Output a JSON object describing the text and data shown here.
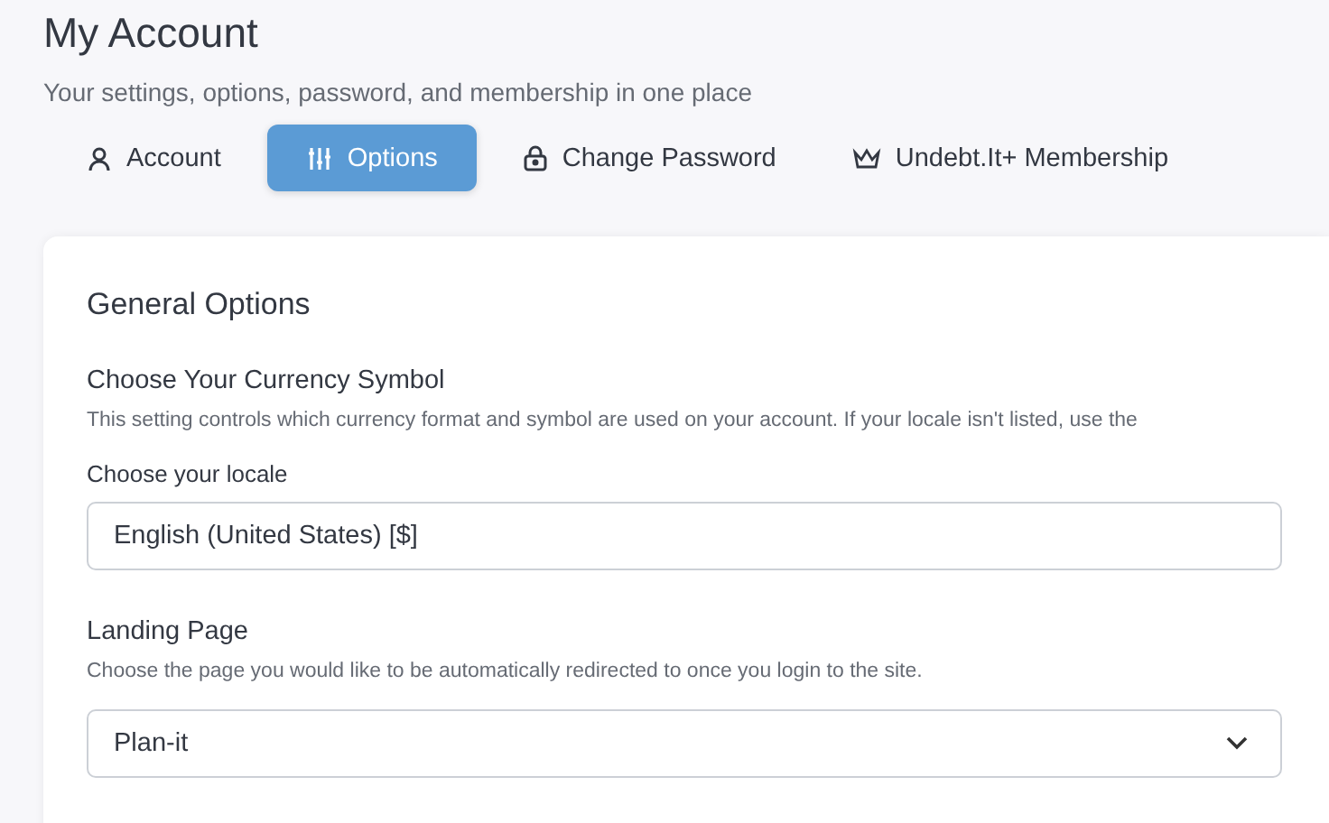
{
  "page": {
    "title": "My Account",
    "subtitle": "Your settings, options, password, and membership in one place"
  },
  "tabs": [
    {
      "label": "Account",
      "selected": false
    },
    {
      "label": "Options",
      "selected": true
    },
    {
      "label": "Change Password",
      "selected": false
    },
    {
      "label": "Undebt.It+ Membership",
      "selected": false
    }
  ],
  "card": {
    "title": "General Options",
    "sections": [
      {
        "kind": "input",
        "heading": "Choose Your Currency Symbol",
        "description": "This setting controls which currency format and symbol are used on your account. If your locale isn't listed, use the",
        "label": "Choose your locale",
        "value": "English (United States) [$]"
      },
      {
        "kind": "select",
        "heading": "Landing Page",
        "description": "Choose the page you would like to be automatically redirected to once you login to the site.",
        "value": "Plan-it"
      }
    ]
  }
}
